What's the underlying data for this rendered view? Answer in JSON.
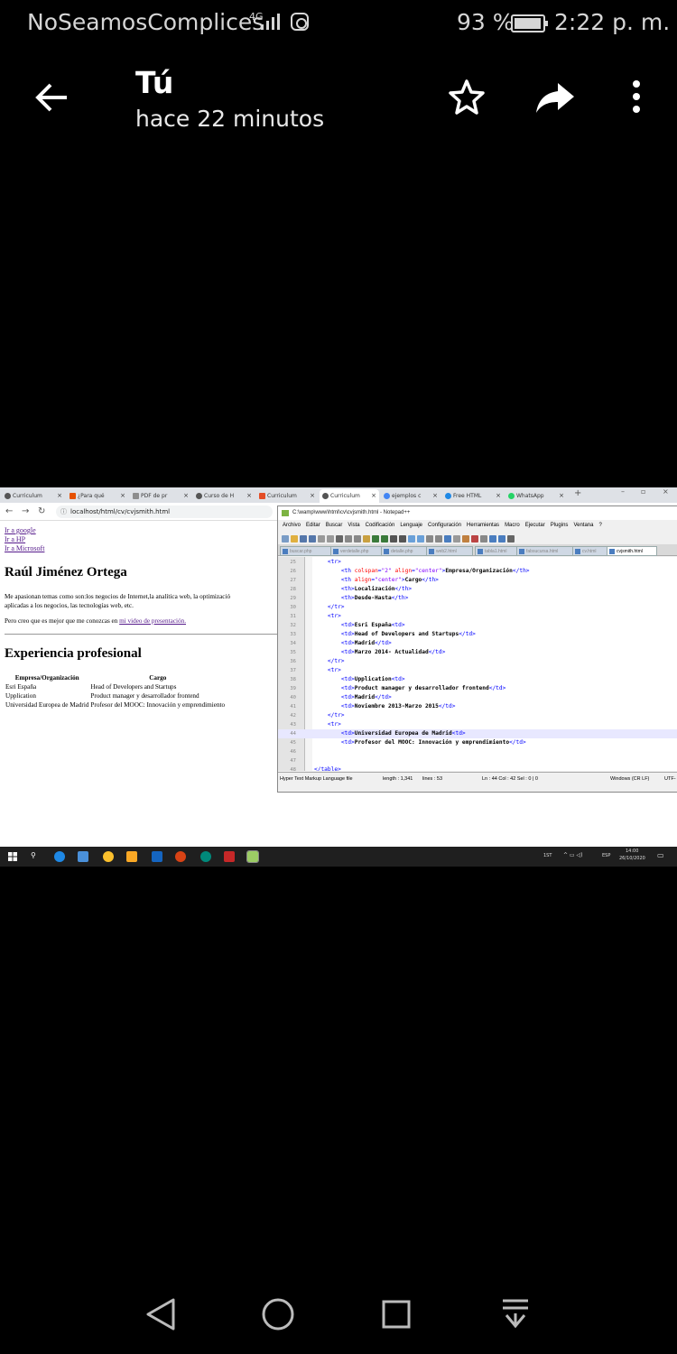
{
  "status_bar": {
    "carrier": "NoSeamosComplices",
    "network": "4G",
    "battery": "93 %",
    "time": "2:22 p. m."
  },
  "header": {
    "title": "Tú",
    "subtitle": "hace 22 minutos"
  },
  "browser": {
    "tabs": [
      "Curriculum",
      "¿Para qué",
      "PDF de pr",
      "Curso de H",
      "Curriculum",
      "Curriculum",
      "ejemplos c",
      "Free HTML",
      "WhatsApp"
    ],
    "url": "localhost/html/cv/cvjsmith.html",
    "page": {
      "links": [
        "Ir a google",
        "Ir a HP",
        "Ir a Microsoft"
      ],
      "name": "Raúl Jiménez Ortega",
      "intro_line1": "Me apasionan temas como son:los negocios de Internet,la analítica web, la optimizació",
      "intro_line2": "aplicadas a los negocios, las tecnologías web, etc.",
      "video_prefix": "Pero creo que es mejor que me conozcas en ",
      "video_link": "mi video de presentación.",
      "section_title": "Experiencia profesional",
      "table_headers": [
        "Empresa/Organización",
        "Cargo"
      ],
      "table_rows": [
        [
          "Esri España",
          "Head of Developers and Startups"
        ],
        [
          "Upplication",
          "Product manager y desarrollador frontend"
        ],
        [
          "Universidad Europea de Madrid",
          "Profesor del MOOC: Innovación y emprendimiento"
        ]
      ]
    }
  },
  "notepad": {
    "title": "C:\\wamp\\www\\html\\cv\\cvjsmith.html - Notepad++",
    "menu": [
      "Archivo",
      "Editar",
      "Buscar",
      "Vista",
      "Codificación",
      "Lenguaje",
      "Configuración",
      "Herramientas",
      "Macro",
      "Ejecutar",
      "Plugins",
      "Ventana",
      "?"
    ],
    "file_tabs": [
      "buscar.php",
      "verdetalle.php",
      "detalle.php",
      "web2.html",
      "tabla1.html",
      "fabsucursa.html",
      "cv.html",
      "cvjsmith.html"
    ],
    "line_numbers": [
      "25",
      "26",
      "27",
      "28",
      "29",
      "30",
      "31",
      "32",
      "33",
      "34",
      "35",
      "36",
      "37",
      "38",
      "39",
      "40",
      "41",
      "42",
      "43",
      "44",
      "45",
      "46",
      "47",
      "48",
      "49"
    ],
    "lines_text": {
      "l26": "Empresa/Organización",
      "l27": "Cargo",
      "l28": "Localización",
      "l29": "Desde-Hasta",
      "l32": "Esri España",
      "l33": "Head of Developers and Startups",
      "l34": "Madrid",
      "l35": "Marzo 2014- Actualidad",
      "l38": "Upplication",
      "l39": "Product manager y desarrollador frontend",
      "l40": "Madrid",
      "l41": "Noviembre 2013-Marzo 2015",
      "l44": "Universidad Europea de Madrid",
      "l45": "Profesor del MOOC: Innovación y emprendimiento"
    },
    "status": {
      "lang": "Hyper Text Markup Language file",
      "length": "length : 1,341",
      "lines": "lines : 53",
      "pos": "Ln : 44    Col : 42    Sel : 0 | 0",
      "eol": "Windows (CR LF)",
      "enc": "UTF-"
    }
  },
  "taskbar": {
    "lang": "ESP",
    "time": "14:00",
    "date": "26/10/2020",
    "tag": "1ST"
  },
  "colors": {
    "background": "#000000",
    "text": "#ffffff",
    "link": "#551a8b"
  }
}
